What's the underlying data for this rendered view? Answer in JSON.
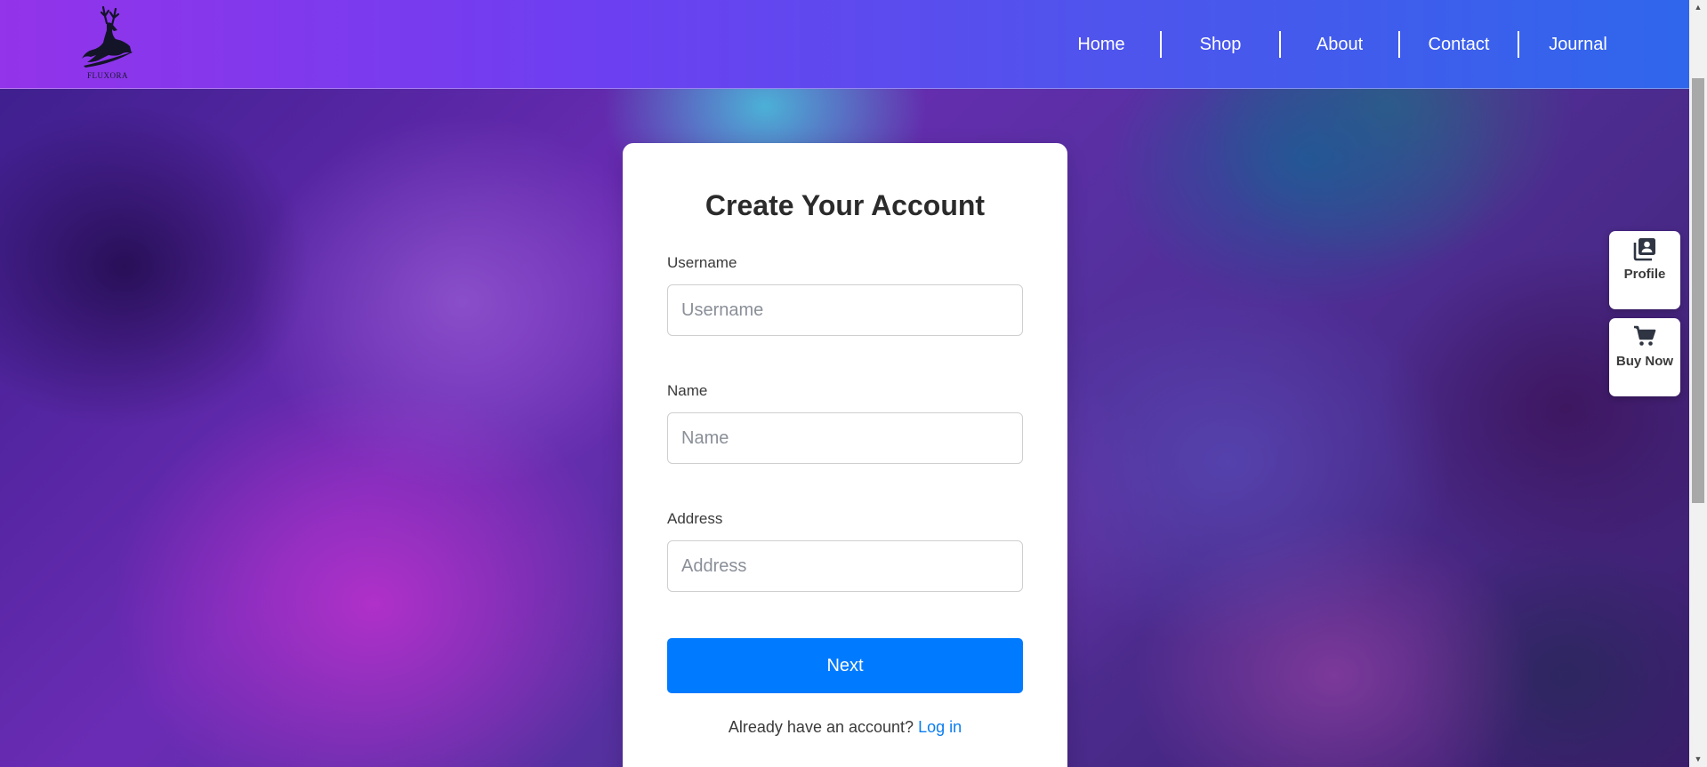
{
  "brand": {
    "logo_text": "FLUXORA"
  },
  "nav": {
    "items": [
      {
        "label": "Home"
      },
      {
        "label": "Shop"
      },
      {
        "label": "About"
      },
      {
        "label": "Contact"
      },
      {
        "label": "Journal"
      }
    ]
  },
  "form": {
    "title": "Create Your Account",
    "fields": [
      {
        "label": "Username",
        "placeholder": "Username",
        "value": ""
      },
      {
        "label": "Name",
        "placeholder": "Name",
        "value": ""
      },
      {
        "label": "Address",
        "placeholder": "Address",
        "value": ""
      }
    ],
    "submit_label": "Next",
    "login_prompt": "Already have an account?",
    "login_link": "Log in"
  },
  "side_actions": [
    {
      "label": "Profile",
      "icon": "profile-icon"
    },
    {
      "label": "Buy Now",
      "icon": "cart-icon"
    }
  ],
  "colors": {
    "header_start": "#9333ea",
    "header_end": "#2f66ec",
    "primary_button": "#007bff",
    "link": "#0a7cf0"
  }
}
